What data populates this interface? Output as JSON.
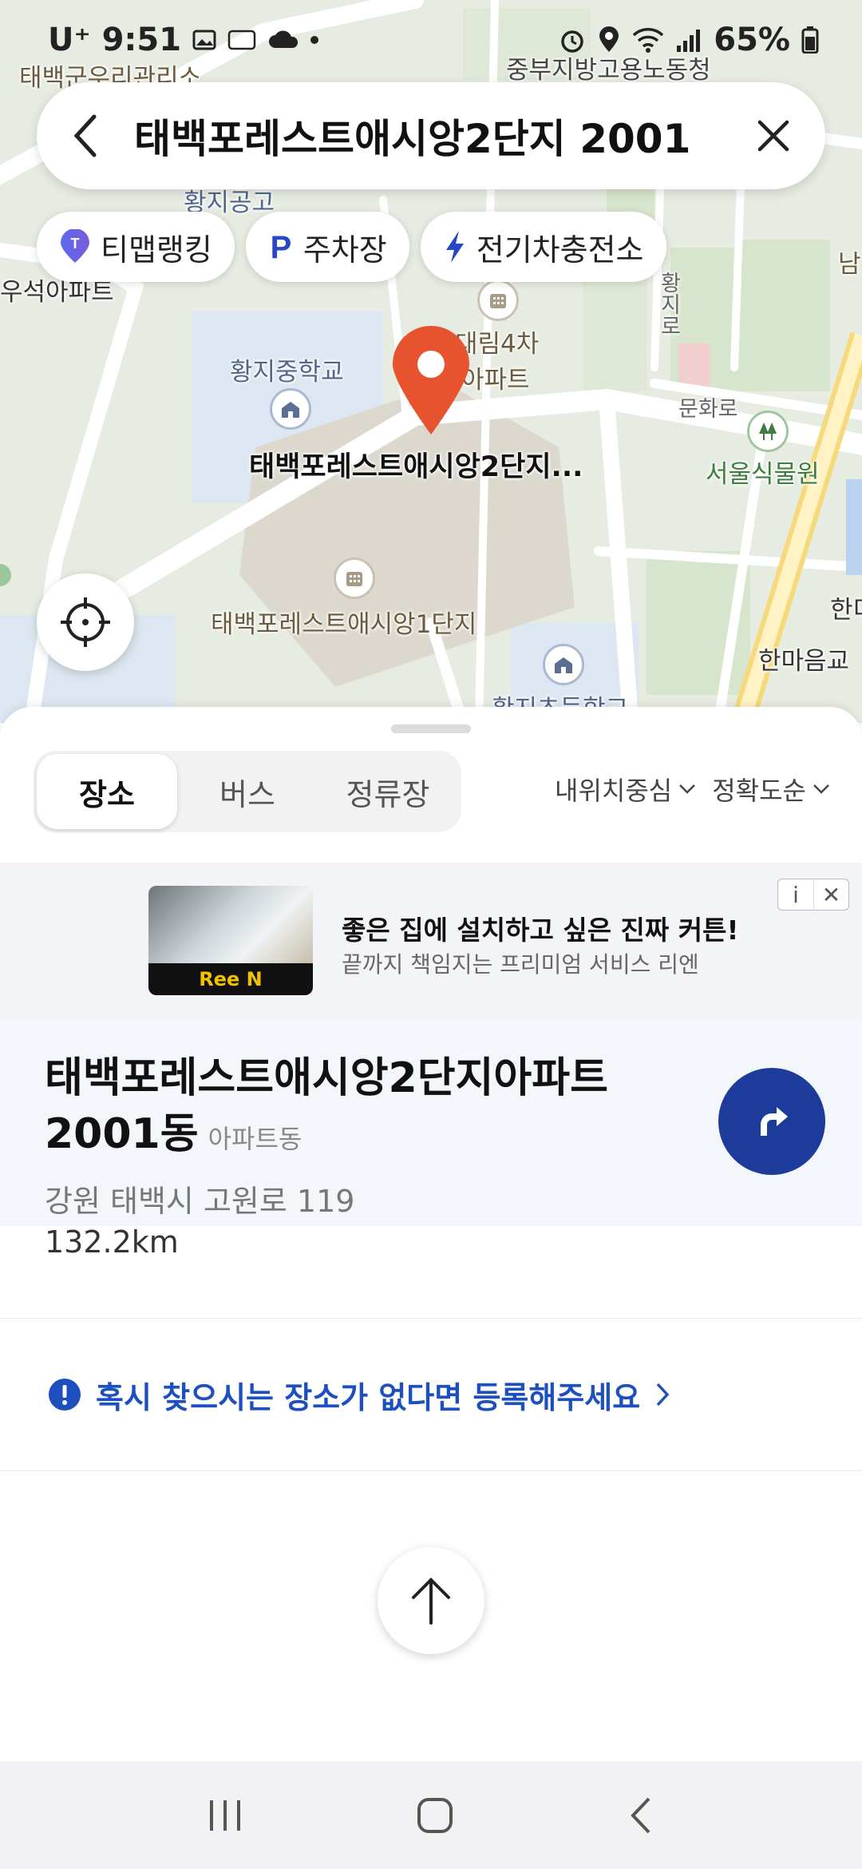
{
  "status_bar": {
    "carrier": "U⁺",
    "time": "9:51",
    "battery": "65%"
  },
  "search": {
    "query": "태백포레스트애시앙2단지 2001"
  },
  "chips": [
    {
      "label": "티맵랭킹",
      "icon": "tmap-ranking-icon"
    },
    {
      "label": "주차장",
      "icon": "parking-icon"
    },
    {
      "label": "전기차충전소",
      "icon": "ev-charging-icon"
    }
  ],
  "map": {
    "labels": {
      "top_left": "태백군우리관리소",
      "top_right": "중부지방고용노동청",
      "mid_school": "황지중학교",
      "apt_daelim_1": "대림4차",
      "apt_daelim_2": "아파트",
      "pin_label": "태백포레스트애시앙2단지...",
      "road": "문화로",
      "park": "서울식물원",
      "apt_1": "태백포레스트애시앙1단지",
      "bottom_right": "한마음교",
      "bottom_school": "황지초등학교",
      "left_edge": "우석아파트",
      "road_vert": "황지로",
      "school_top": "황지공고",
      "right_edge_1": "남",
      "right_edge_2": "한디"
    },
    "accent_pin_color": "#e8532f"
  },
  "sheet": {
    "tabs": [
      {
        "label": "장소",
        "active": true
      },
      {
        "label": "버스",
        "active": false
      },
      {
        "label": "정류장",
        "active": false
      }
    ],
    "sort_options": [
      "내위치중심",
      "정확도순"
    ]
  },
  "ad": {
    "brand": "Ree N",
    "title": "좋은 집에 설치하고 싶은 진짜 커튼!",
    "description": "끝까지 책임지는 프리미엄 서비스 리엔",
    "info_badge": "i",
    "close_badge": "✕"
  },
  "result": {
    "name_line1": "태백포레스트애시앙2단지아파트",
    "name_line2": "2001동",
    "category": "아파트동",
    "address": "강원 태백시 고원로 119",
    "distance": "132.2km",
    "route_color": "#1c3b9b"
  },
  "register": {
    "text": "혹시 찾으시는 장소가 없다면 등록해주세요"
  }
}
